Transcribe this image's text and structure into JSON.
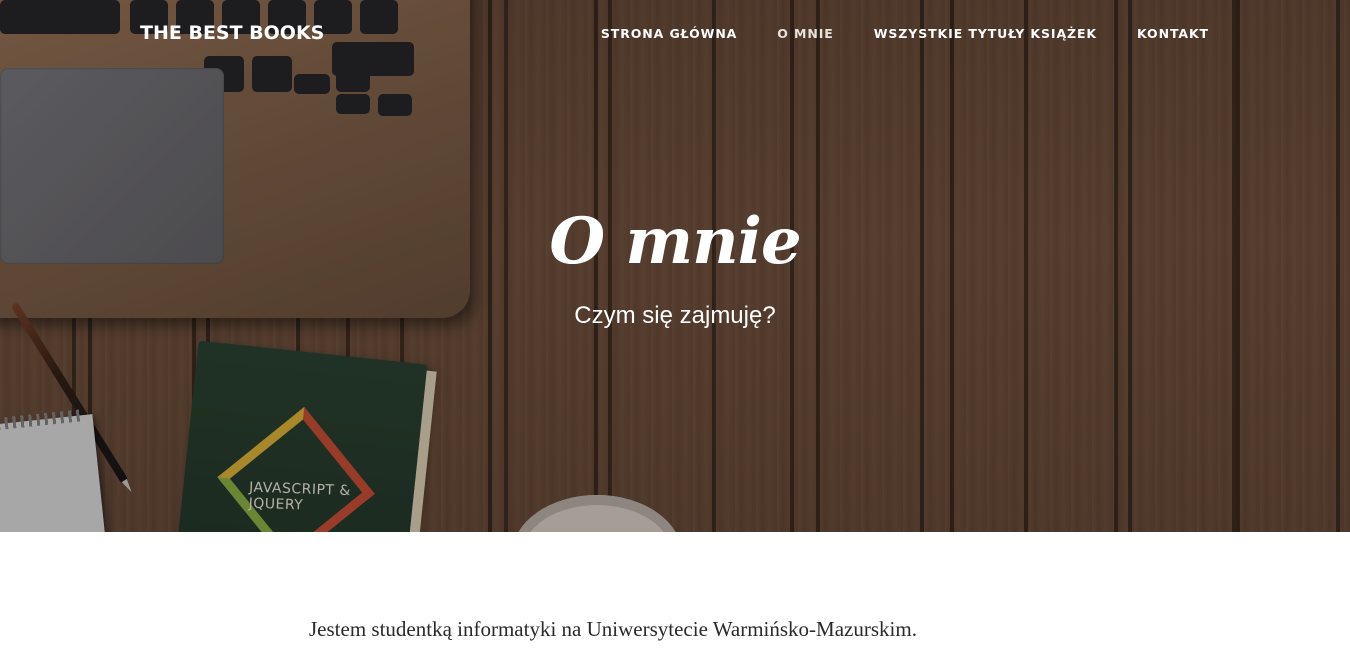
{
  "navbar": {
    "brand": "THE BEST BOOKS",
    "links": [
      {
        "label": "STRONA GŁÓWNA",
        "active": false
      },
      {
        "label": "O MNIE",
        "active": true
      },
      {
        "label": "WSZYSTKIE TYTUŁY KSIĄŻEK",
        "active": false
      },
      {
        "label": "KONTAKT",
        "active": false
      }
    ]
  },
  "hero": {
    "title": "O mnie",
    "subtitle": "Czym się zajmuję?",
    "book_cover_text": "JAVASCRIPT & JQUERY"
  },
  "content": {
    "paragraph": "Jestem studentką informatyki na Uniwersytecie Warmińsko-Mazurskim."
  },
  "colors": {
    "hero_wood": "#5e4432",
    "text_white": "#ffffff",
    "body_text": "#2a2a2a"
  }
}
